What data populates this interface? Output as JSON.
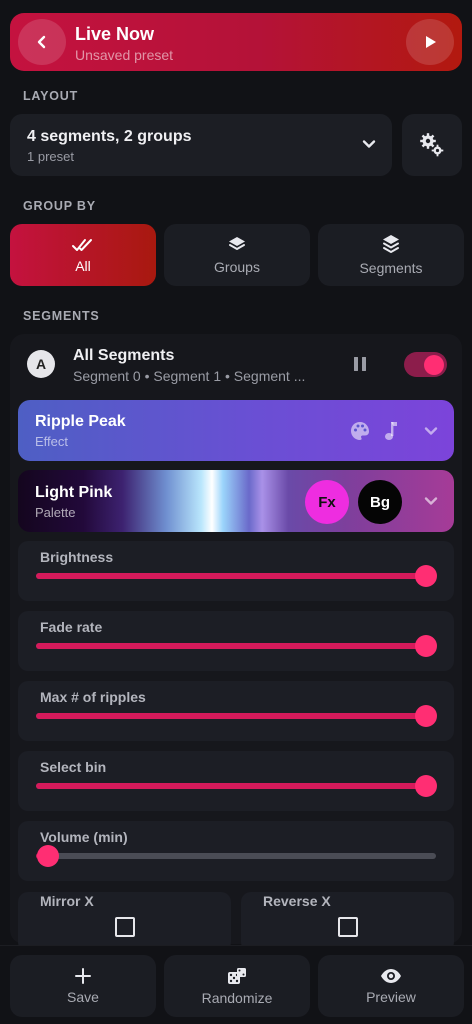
{
  "header": {
    "title": "Live Now",
    "subtitle": "Unsaved preset"
  },
  "layout_section": {
    "label": "LAYOUT",
    "selected_value": "4 segments, 2 groups",
    "selected_sub": "1 preset"
  },
  "group_by": {
    "label": "GROUP BY",
    "tabs": [
      {
        "label": "All",
        "icon": "double-check-icon",
        "active": true
      },
      {
        "label": "Groups",
        "icon": "layers-icon",
        "active": false
      },
      {
        "label": "Segments",
        "icon": "layers-stack-icon",
        "active": false
      }
    ]
  },
  "segments": {
    "label": "SEGMENTS",
    "all_segments": {
      "avatar": "A",
      "title": "All Segments",
      "subtitle": "Segment 0 • Segment 1 • Segment ...",
      "enabled": true
    },
    "effect": {
      "name": "Ripple Peak",
      "sub": "Effect",
      "icons": [
        "palette-icon",
        "music-note-icon",
        "chevron-down-icon"
      ]
    },
    "palette": {
      "name": "Light Pink",
      "sub": "Palette",
      "fx_label": "Fx",
      "bg_label": "Bg"
    },
    "sliders": [
      {
        "label": "Brightness",
        "value_fraction": 0.975
      },
      {
        "label": "Fade rate",
        "value_fraction": 0.975
      },
      {
        "label": "Max # of ripples",
        "value_fraction": 0.975
      },
      {
        "label": "Select bin",
        "value_fraction": 0.975
      },
      {
        "label": "Volume (min)",
        "value_fraction": 0.03
      }
    ],
    "checkboxes": [
      {
        "label": "Mirror X",
        "checked": false
      },
      {
        "label": "Reverse X",
        "checked": false
      }
    ]
  },
  "bottom_actions": [
    {
      "label": "Save",
      "icon": "plus-icon"
    },
    {
      "label": "Randomize",
      "icon": "dice-icon"
    },
    {
      "label": "Preview",
      "icon": "eye-icon"
    }
  ],
  "colors": {
    "accent": "#ff2e73",
    "banner_start": "#c4123f",
    "banner_end": "#b2190f",
    "effect_start": "#4e5fc4",
    "effect_end": "#7c44da",
    "palette_fx": "#ee2de0",
    "background": "#111216"
  }
}
